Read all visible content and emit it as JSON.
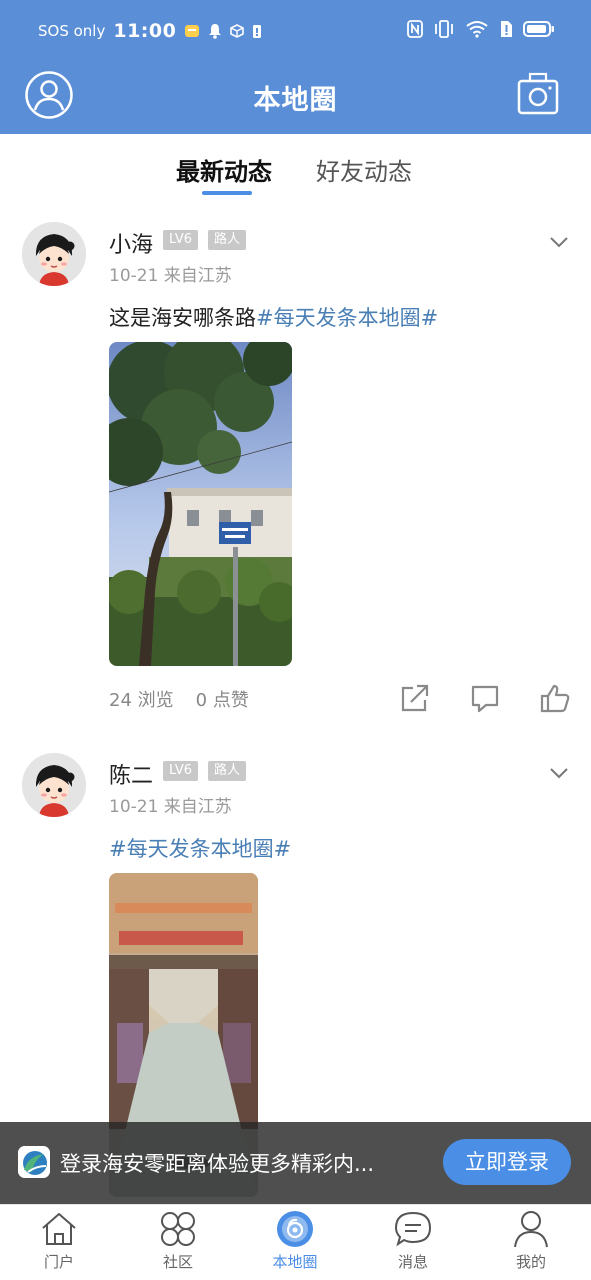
{
  "status_bar": {
    "carrier": "SOS only",
    "time": "11:00"
  },
  "header": {
    "title": "本地圈",
    "avatar_icon": "user-circle-icon",
    "camera_icon": "camera-icon",
    "color": "#5a8fd8"
  },
  "tabs": [
    {
      "label": "最新动态",
      "active": true
    },
    {
      "label": "好友动态",
      "active": false
    }
  ],
  "posts": [
    {
      "user": "小海",
      "level": "LV6",
      "role": "路人",
      "date": "10-21",
      "source": "来自江苏",
      "text": "这是海安哪条路",
      "tag": "#每天发条本地圈#",
      "views": "24 浏览",
      "likes": "0 点赞"
    },
    {
      "user": "陈二",
      "level": "LV6",
      "role": "路人",
      "date": "10-21",
      "source": "来自江苏",
      "text": "",
      "tag": "#每天发条本地圈#"
    }
  ],
  "banner": {
    "text": "登录海安零距离体验更多精彩内...",
    "button": "立即登录"
  },
  "bottom_nav": [
    {
      "label": "门户",
      "icon": "home-icon",
      "active": false
    },
    {
      "label": "社区",
      "icon": "clover-icon",
      "active": false
    },
    {
      "label": "本地圈",
      "icon": "local-circle-icon",
      "active": true
    },
    {
      "label": "消息",
      "icon": "message-icon",
      "active": false
    },
    {
      "label": "我的",
      "icon": "person-icon",
      "active": false
    }
  ],
  "accent_color": "#4a8ee6",
  "tag_color": "#4a7fb5"
}
